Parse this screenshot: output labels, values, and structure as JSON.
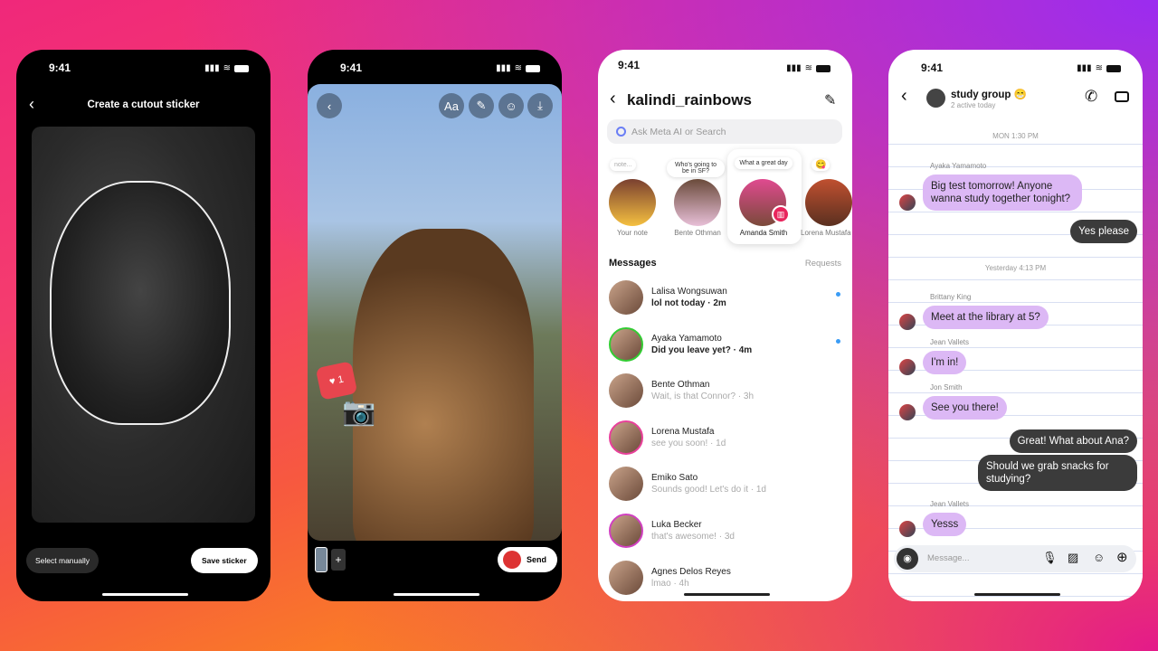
{
  "status_time": "9:41",
  "phone1": {
    "title": "Create a cutout sticker",
    "select_manually": "Select manually",
    "save_sticker": "Save sticker"
  },
  "phone2": {
    "toolbar": {
      "text_label": "Aa"
    },
    "like_count": "1",
    "send": "Send"
  },
  "phone3": {
    "username": "kalindi_rainbows",
    "search_placeholder": "Ask Meta AI or Search",
    "notes": [
      {
        "note": "note...",
        "name": "Your note"
      },
      {
        "note": "Who's going to be in SF?",
        "name": "Bente Othman"
      },
      {
        "note": "What a great day",
        "name": "Amanda Smith"
      },
      {
        "note": "😋",
        "name": "Lorena Mustafa"
      }
    ],
    "messages_label": "Messages",
    "requests_label": "Requests",
    "threads": [
      {
        "name": "Lalisa Wongsuwan",
        "preview": "lol not today · 2m",
        "unread": true
      },
      {
        "name": "Ayaka Yamamoto",
        "preview": "Did you leave yet? · 4m",
        "unread": true
      },
      {
        "name": "Bente Othman",
        "preview": "Wait, is that Connor? · 3h",
        "unread": false
      },
      {
        "name": "Lorena Mustafa",
        "preview": "see you soon! · 1d",
        "unread": false
      },
      {
        "name": "Emiko Sato",
        "preview": "Sounds good! Let's do it · 1d",
        "unread": false
      },
      {
        "name": "Luka Becker",
        "preview": "that's awesome! · 3d",
        "unread": false
      },
      {
        "name": "Agnes Delos Reyes",
        "preview": "lmao · 4h",
        "unread": false
      }
    ]
  },
  "phone4": {
    "group_name": "study group 😁",
    "active": "2 active today",
    "date1": "MON 1:30 PM",
    "date2": "Yesterday 4:13 PM",
    "messages": [
      {
        "sender": "Ayaka Yamamoto",
        "text": "Big test tomorrow! Anyone wanna study together tonight?"
      },
      {
        "text": "Yes please"
      },
      {
        "sender": "Brittany King",
        "text": "Meet at the library at 5?"
      },
      {
        "sender": "Jean Vallets",
        "text": "I'm in!"
      },
      {
        "sender": "Jon Smith",
        "text": "See you there!"
      },
      {
        "text": "Great! What about Ana?"
      },
      {
        "text": "Should we grab snacks for studying?"
      },
      {
        "sender": "Jean Vallets",
        "text": "Yesss"
      }
    ],
    "input_placeholder": "Message..."
  },
  "colors": {
    "incoming_bubble": "#dcb8f5",
    "outgoing_bubble": "#3b3b3b",
    "unread_dot": "#3a9cf5"
  }
}
